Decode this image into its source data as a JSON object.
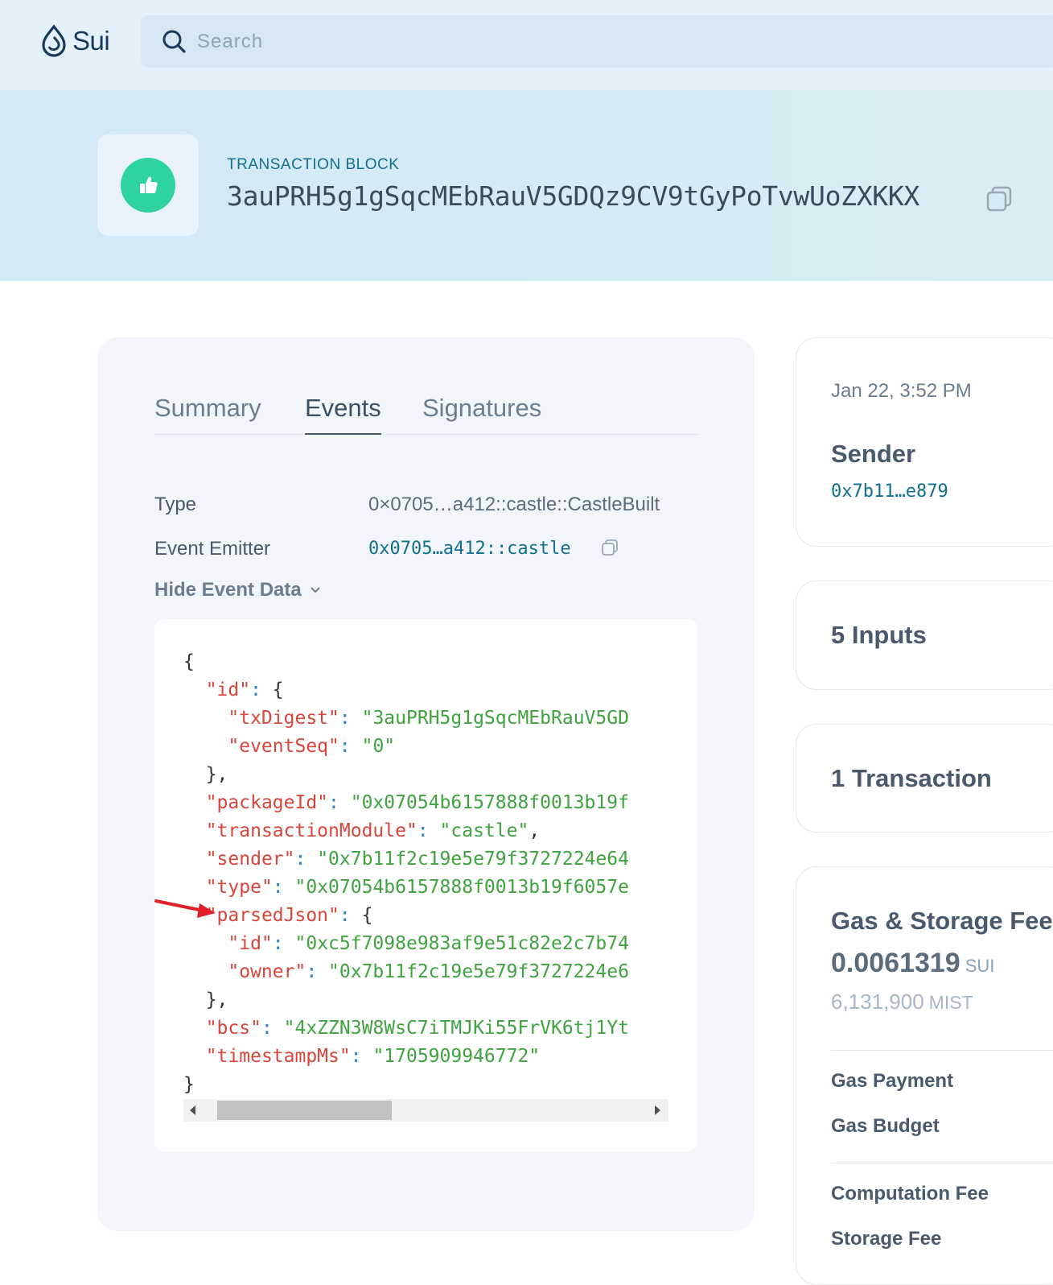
{
  "header": {
    "logo_text": "Sui",
    "search_placeholder": "Search"
  },
  "hero": {
    "eyebrow": "TRANSACTION BLOCK",
    "digest": "3auPRH5g1gSqcMEbRauV5GDQz9CV9tGyPoTvwUoZXKKX"
  },
  "tabs": [
    {
      "label": "Summary",
      "active": false
    },
    {
      "label": "Events",
      "active": true
    },
    {
      "label": "Signatures",
      "active": false
    }
  ],
  "event": {
    "type_label": "Type",
    "type_value": "0×0705…a412::castle::CastleBuilt",
    "emitter_label": "Event Emitter",
    "emitter_value": "0x0705…a412::castle",
    "toggle_label": "Hide Event Data"
  },
  "json_lines": [
    "{",
    "  \"id\": {",
    "    \"txDigest\": \"3auPRH5g1gSqcMEbRauV5GD",
    "    \"eventSeq\": \"0\"",
    "  },",
    "  \"packageId\": \"0x07054b6157888f0013b19f",
    "  \"transactionModule\": \"castle\",",
    "  \"sender\": \"0x7b11f2c19e5e79f3727224e64",
    "  \"type\": \"0x07054b6157888f0013b19f6057e",
    "  \"parsedJson\": {",
    "    \"id\": \"0xc5f7098e983af9e51c82e2c7b74",
    "    \"owner\": \"0x7b11f2c19e5e79f3727224e6",
    "  },",
    "  \"bcs\": \"4xZZN3W8WsC7iTMJKi55FrVK6tj1Yt",
    "  \"timestampMs\": \"1705909946772\"",
    "}"
  ],
  "sidebar": {
    "date": "Jan 22, 3:52 PM",
    "sender_heading": "Sender",
    "sender_address": "0x7b11…e879",
    "inputs": "5 Inputs",
    "transactions": "1 Transaction",
    "gas_heading": "Gas & Storage Fee",
    "gas_total": "0.0061319",
    "gas_unit": "SUI",
    "gas_mist": "6,131,900",
    "gas_mist_unit": "MIST",
    "gas_payment": "Gas Payment",
    "gas_budget": "Gas Budget",
    "computation_fee": "Computation Fee",
    "storage_fee": "Storage Fee"
  },
  "colors": {
    "accent": "#12708f",
    "success": "#2fd3a0",
    "json_key": "#d9453b",
    "json_string": "#3fa33f",
    "annotation_arrow": "#e0202a"
  }
}
